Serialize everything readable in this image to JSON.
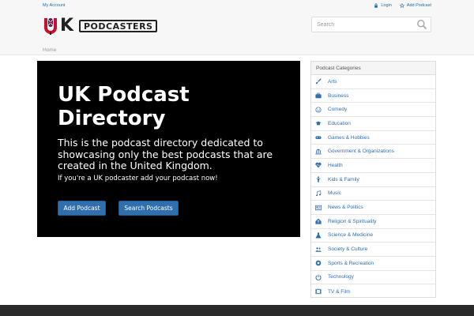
{
  "header": {
    "account_link": "My Account",
    "login_link": "Login",
    "add_podcast_link": "Add Podcast",
    "brand": "PODCASTERS",
    "brand_letter": "K"
  },
  "search": {
    "placeholder": "Search"
  },
  "breadcrumb": {
    "home": "Home"
  },
  "hero": {
    "title": "UK Podcast Directory",
    "lead": "This is the podcast directory dedicated to showcasing only the best podcasts that are created in the United Kingdom.",
    "sub": "If you're a UK podcaster add your podcast now!",
    "add_button": "Add Podcast",
    "search_button": "Search Podcasts"
  },
  "categories": {
    "heading": "Podcast Categories",
    "items": [
      {
        "label": "Arts",
        "icon": "brush-icon"
      },
      {
        "label": "Business",
        "icon": "briefcase-icon"
      },
      {
        "label": "Comedy",
        "icon": "smile-icon"
      },
      {
        "label": "Education",
        "icon": "graduation-cap-icon"
      },
      {
        "label": "Games & Hobbies",
        "icon": "gamepad-icon"
      },
      {
        "label": "Government & Organizations",
        "icon": "institution-icon"
      },
      {
        "label": "Health",
        "icon": "heartbeat-icon"
      },
      {
        "label": "Kids & Family",
        "icon": "child-icon"
      },
      {
        "label": "Music",
        "icon": "music-icon"
      },
      {
        "label": "News & Politics",
        "icon": "newspaper-icon"
      },
      {
        "label": "Religion & Spirituality",
        "icon": "religion-icon"
      },
      {
        "label": "Science & Medicine",
        "icon": "flask-icon"
      },
      {
        "label": "Society & Culture",
        "icon": "users-icon"
      },
      {
        "label": "Sports & Recreation",
        "icon": "soccer-ball-icon"
      },
      {
        "label": "Technology",
        "icon": "power-icon"
      },
      {
        "label": "TV & Film",
        "icon": "film-icon"
      }
    ]
  },
  "colors": {
    "accent": "#2f6fae",
    "hero_bg": "#000000",
    "link": "#1e6aa8",
    "footer": "#2a2a2a"
  }
}
